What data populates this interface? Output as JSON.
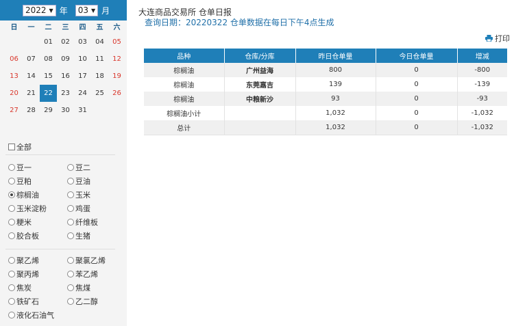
{
  "calendar": {
    "year": "2022",
    "year_unit": "年",
    "month": "03",
    "month_unit": "月",
    "weekdays": [
      "日",
      "一",
      "二",
      "三",
      "四",
      "五",
      "六"
    ],
    "days": [
      "",
      "",
      "01",
      "02",
      "03",
      "04",
      "05",
      "06",
      "07",
      "08",
      "09",
      "10",
      "11",
      "12",
      "13",
      "14",
      "15",
      "16",
      "17",
      "18",
      "19",
      "20",
      "21",
      "22",
      "23",
      "24",
      "25",
      "26",
      "27",
      "28",
      "29",
      "30",
      "31",
      "",
      ""
    ],
    "selected_day": "22",
    "accent_color": "#1f7fb8"
  },
  "filter": {
    "all_label": "全部",
    "group1": [
      "豆一",
      "豆二",
      "豆粕",
      "豆油",
      "棕榈油",
      "玉米",
      "玉米淀粉",
      "鸡蛋",
      "粳米",
      "纤维板",
      "胶合板",
      "生猪"
    ],
    "group2": [
      "聚乙烯",
      "聚氯乙烯",
      "聚丙烯",
      "苯乙烯",
      "焦炭",
      "焦煤",
      "铁矿石",
      "乙二醇",
      "液化石油气"
    ],
    "selected": "棕榈油"
  },
  "report": {
    "title": "大连商品交易所 仓单日报",
    "query": "查询日期：20220322 仓单数据在每日下午4点生成",
    "print_label": "打印",
    "columns": [
      "品种",
      "仓库/分库",
      "昨日仓单量",
      "今日仓单量",
      "增减"
    ],
    "rows": [
      [
        "棕榈油",
        "广州益海",
        "800",
        "0",
        "-800"
      ],
      [
        "棕榈油",
        "东莞嘉吉",
        "139",
        "0",
        "-139"
      ],
      [
        "棕榈油",
        "中粮新沙",
        "93",
        "0",
        "-93"
      ],
      [
        "棕榈油小计",
        "",
        "1,032",
        "0",
        "-1,032"
      ],
      [
        "总计",
        "",
        "1,032",
        "0",
        "-1,032"
      ]
    ]
  }
}
